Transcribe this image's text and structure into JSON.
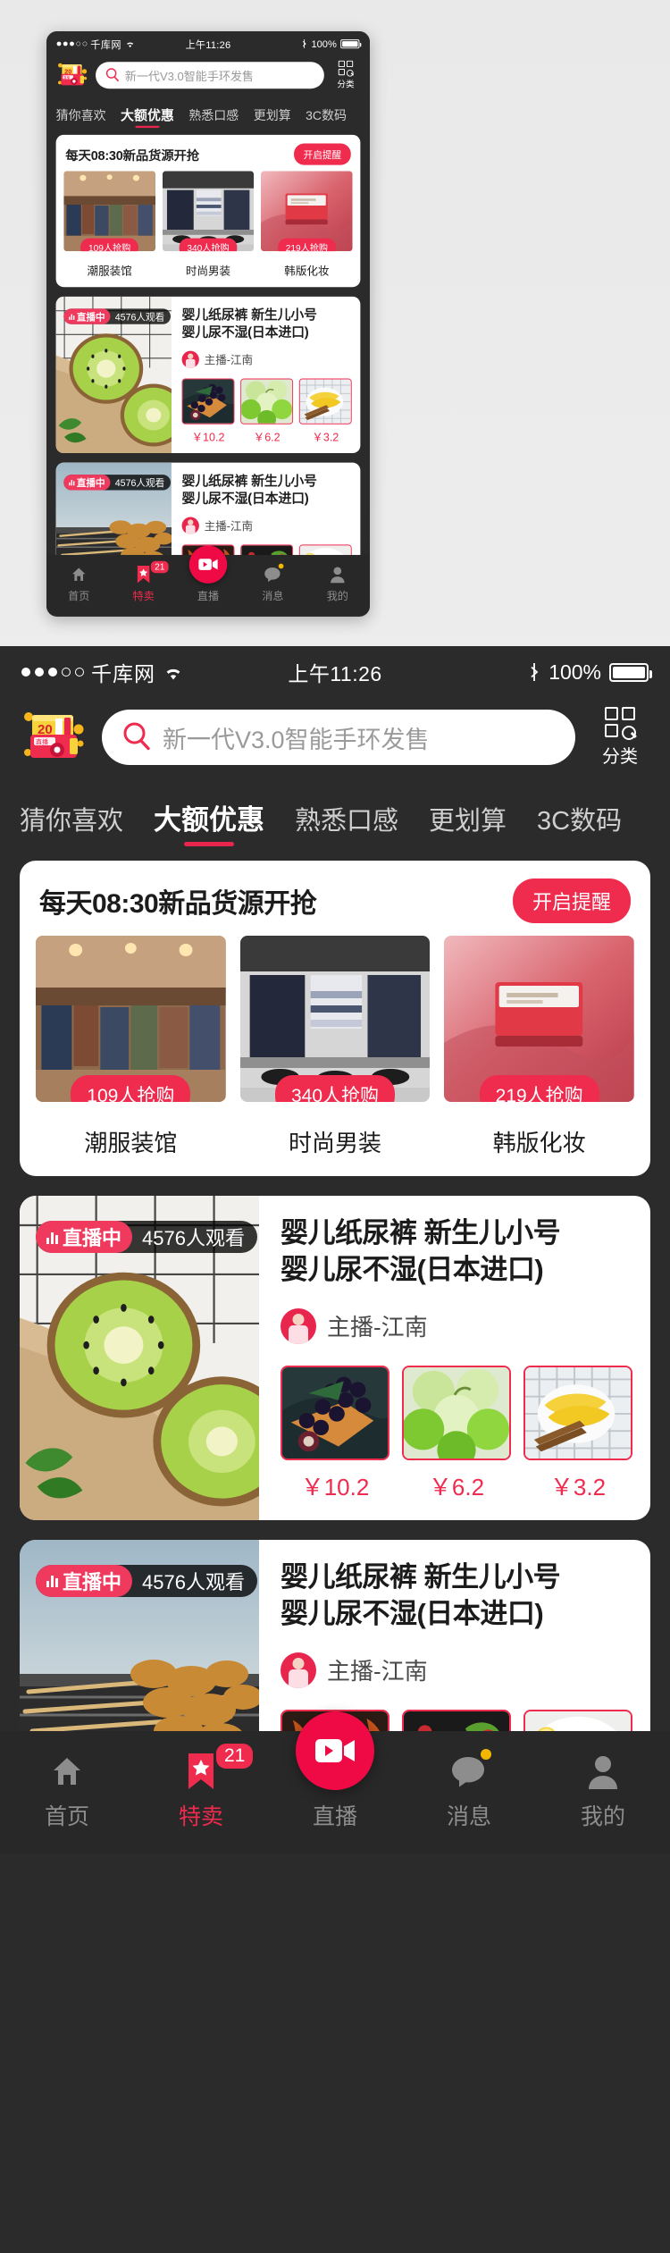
{
  "status_bar": {
    "signal_dots_filled": 3,
    "signal_dots_total": 5,
    "carrier": "千库网",
    "wifi_icon": "wifi-icon",
    "time": "上午11:26",
    "bluetooth_icon": "bluetooth-icon",
    "battery_percent": "100%"
  },
  "header": {
    "promo_icon": "promo-gift-icon",
    "promo_icon_number": "20",
    "promo_icon_label": "直播",
    "search": {
      "icon": "search-icon",
      "placeholder": "新一代V3.0智能手环发售"
    },
    "category_button": {
      "icon": "grid-category-icon",
      "label": "分类"
    }
  },
  "tabs": [
    {
      "label": "猜你喜欢",
      "active": false
    },
    {
      "label": "大额优惠",
      "active": true
    },
    {
      "label": "熟悉口感",
      "active": false
    },
    {
      "label": "更划算",
      "active": false
    },
    {
      "label": "3C数码",
      "active": false
    }
  ],
  "flash_sale": {
    "title": "每天08:30新品货源开抢",
    "button_label": "开启提醒",
    "items": [
      {
        "name": "潮服装馆",
        "badge": "109人抢购",
        "image": "clothing-store-photo"
      },
      {
        "name": "时尚男装",
        "badge": "340人抢购",
        "image": "mens-suits-photo"
      },
      {
        "name": "韩版化妆",
        "badge": "219人抢购",
        "image": "red-cosmetics-photo"
      }
    ]
  },
  "live_cards": [
    {
      "live_label": "直播中",
      "live_icon": "signal-bars-icon",
      "viewers": "4576人观看",
      "cover_image": "kiwi-fruit-photo",
      "title_line1": "婴儿纸尿裤 新生儿小号",
      "title_line2": "婴儿尿不湿(日本进口)",
      "anchor_avatar": "anchor-avatar",
      "anchor_label": "主播-江南",
      "products": [
        {
          "price": "￥10.2",
          "image": "grapes-photo"
        },
        {
          "price": "￥6.2",
          "image": "green-apples-photo"
        },
        {
          "price": "￥3.2",
          "image": "bananas-photo"
        }
      ]
    },
    {
      "live_label": "直播中",
      "live_icon": "signal-bars-icon",
      "viewers": "4576人观看",
      "cover_image": "bbq-skewers-photo",
      "title_line1": "婴儿纸尿裤 新生儿小号",
      "title_line2": "婴儿尿不湿(日本进口)",
      "anchor_avatar": "anchor-avatar",
      "anchor_label": "主播-江南",
      "products": [
        {
          "price": "",
          "image": "fried-skewers-photo"
        },
        {
          "price": "",
          "image": "raw-meat-salad-photo"
        },
        {
          "price": "",
          "image": "steak-plate-photo"
        }
      ]
    }
  ],
  "bottom_nav": [
    {
      "label": "首页",
      "icon": "home-icon",
      "active": false,
      "badge": ""
    },
    {
      "label": "特卖",
      "icon": "bookmark-star-icon",
      "active": true,
      "badge": "21"
    },
    {
      "label": "直播",
      "icon": "video-camera-icon",
      "active": false,
      "badge": "",
      "fab": true
    },
    {
      "label": "消息",
      "icon": "chat-bubble-icon",
      "active": false,
      "badge": "",
      "dot": true
    },
    {
      "label": "我的",
      "icon": "user-icon",
      "active": false,
      "badge": ""
    }
  ],
  "colors": {
    "accent_red": "#ef2b4e",
    "fab_red": "#ef0a46",
    "frame_dark": "#2b2b2b",
    "nav_dark": "#282828",
    "page_bg": "#e9e9e9"
  }
}
